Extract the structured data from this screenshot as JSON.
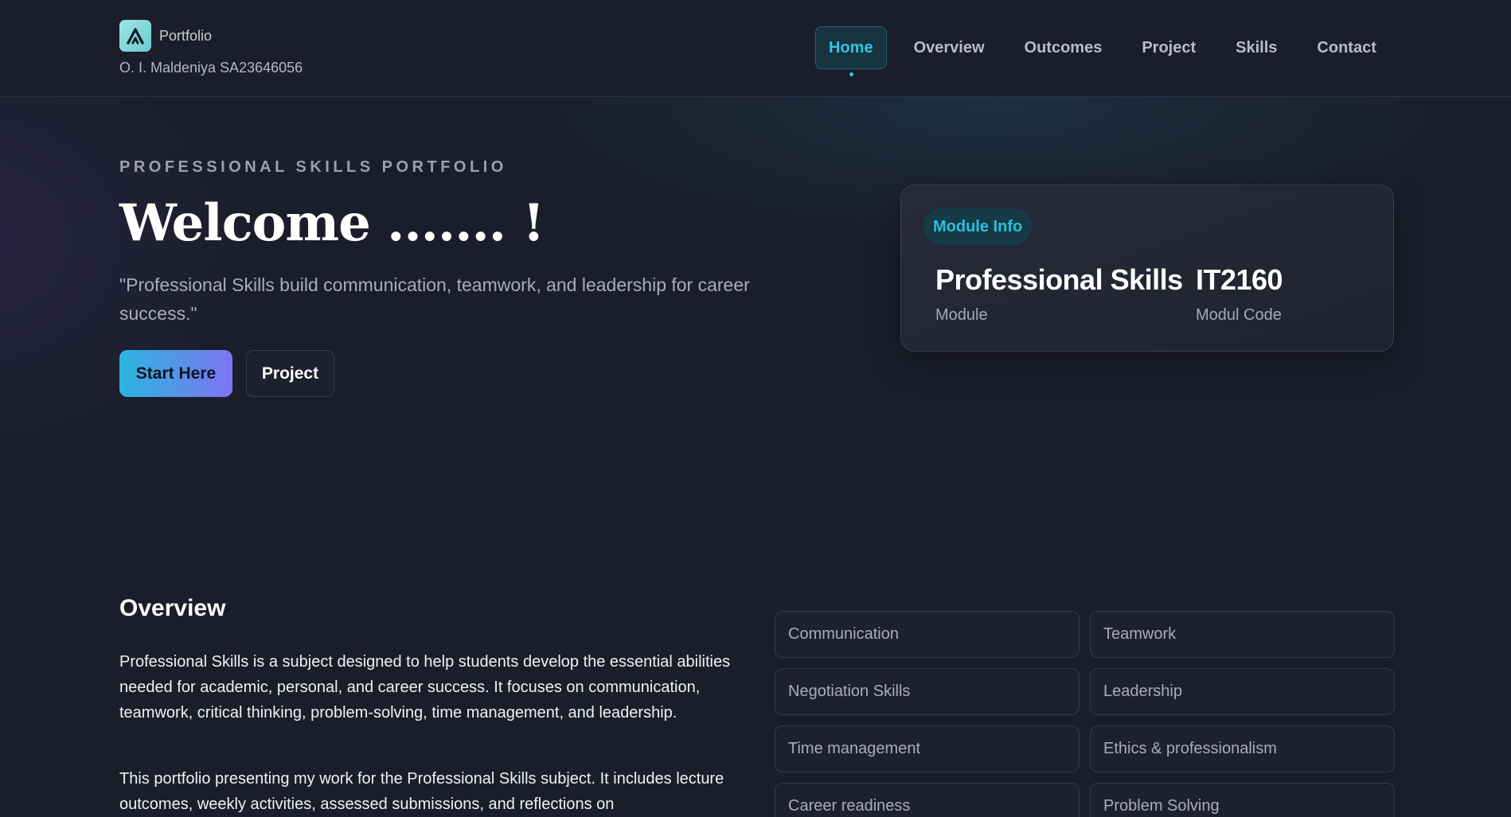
{
  "brand": {
    "title": "Portfolio",
    "subtitle": "O. I. Maldeniya SA23646056",
    "logo_icon": "mountain-a-icon",
    "logo_color": "#8fdcdc"
  },
  "nav": {
    "items": [
      {
        "label": "Home",
        "active": true
      },
      {
        "label": "Overview",
        "active": false
      },
      {
        "label": "Outcomes",
        "active": false
      },
      {
        "label": "Project",
        "active": false
      },
      {
        "label": "Skills",
        "active": false
      },
      {
        "label": "Contact",
        "active": false
      }
    ]
  },
  "hero": {
    "eyebrow": "PROFESSIONAL SKILLS PORTFOLIO",
    "title": "Welcome ....... !",
    "quote": "\"Professional Skills build communication, teamwork, and leadership for career success.\"",
    "primary_button": "Start Here",
    "secondary_button": "Project"
  },
  "module_card": {
    "badge": "Module Info",
    "module_name": "Professional Skills",
    "module_name_label": "Module",
    "module_code": "IT2160",
    "module_code_label": "Modul Code"
  },
  "overview": {
    "title": "Overview",
    "paragraphs": [
      "Professional Skills is a subject designed to help students develop the essential abilities needed for academic, personal, and career success. It focuses on communication, teamwork, critical thinking, problem-solving, time management, and leadership.",
      "This portfolio presenting my work for the Professional Skills subject. It includes lecture outcomes, weekly activities, assessed submissions, and reflections on"
    ],
    "skills": [
      "Communication",
      "Teamwork",
      "Negotiation Skills",
      "Leadership",
      "Time management",
      "Ethics & professionalism",
      "Career readiness",
      "Problem Solving"
    ]
  },
  "colors": {
    "background": "#1b1d2b",
    "accent": "#30c5e0",
    "button_gradient_start": "#2bb6df",
    "button_gradient_end": "#7d74f2"
  }
}
